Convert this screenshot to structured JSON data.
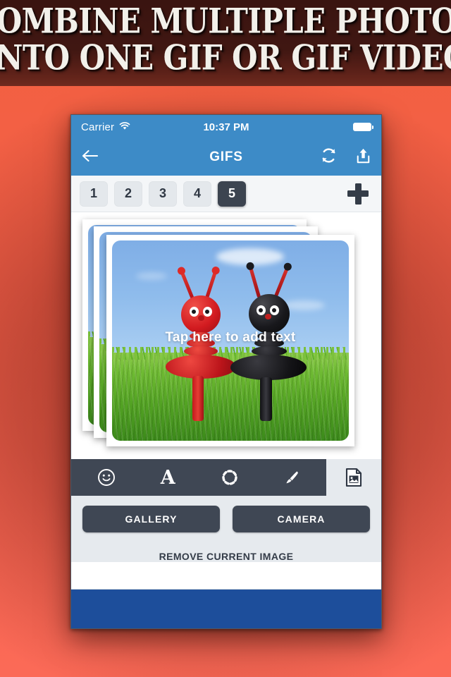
{
  "banner": {
    "line1": "COMBINE MULTIPLE PHOTOS",
    "line2": "INTO ONE GIF OR GIF VIDEO"
  },
  "status_bar": {
    "carrier": "Carrier",
    "wifi_icon": "wifi-icon",
    "time": "10:37 PM",
    "battery_icon": "battery-full-icon"
  },
  "nav_bar": {
    "back_icon": "back-arrow-icon",
    "title": "GIFS",
    "refresh_icon": "refresh-icon",
    "share_icon": "share-upload-icon"
  },
  "frame_tabs": {
    "items": [
      {
        "label": "1",
        "selected": false
      },
      {
        "label": "2",
        "selected": false
      },
      {
        "label": "3",
        "selected": false
      },
      {
        "label": "4",
        "selected": false
      },
      {
        "label": "5",
        "selected": true
      }
    ],
    "add_icon": "plus-icon"
  },
  "canvas": {
    "overlay_text": "Tap here to add text",
    "photo_count": 3,
    "photo_subject": "two clay ant figurines in grass under blue sky"
  },
  "edit_toolbar": {
    "tools": [
      {
        "name": "sticker-icon",
        "label": ""
      },
      {
        "name": "text-icon",
        "label": "A"
      },
      {
        "name": "frame-icon",
        "label": ""
      },
      {
        "name": "brush-icon",
        "label": ""
      }
    ],
    "image_tool_icon": "image-file-icon"
  },
  "actions": {
    "gallery_label": "GALLERY",
    "camera_label": "CAMERA",
    "remove_label": "REMOVE CURRENT IMAGE"
  },
  "colors": {
    "background": "#F2604A",
    "banner": "#3A1410",
    "nav_blue": "#3D8BC7",
    "dark_ui": "#3F4754",
    "footer_blue": "#1D4E9B",
    "panel_gray": "#E6EAEE"
  }
}
